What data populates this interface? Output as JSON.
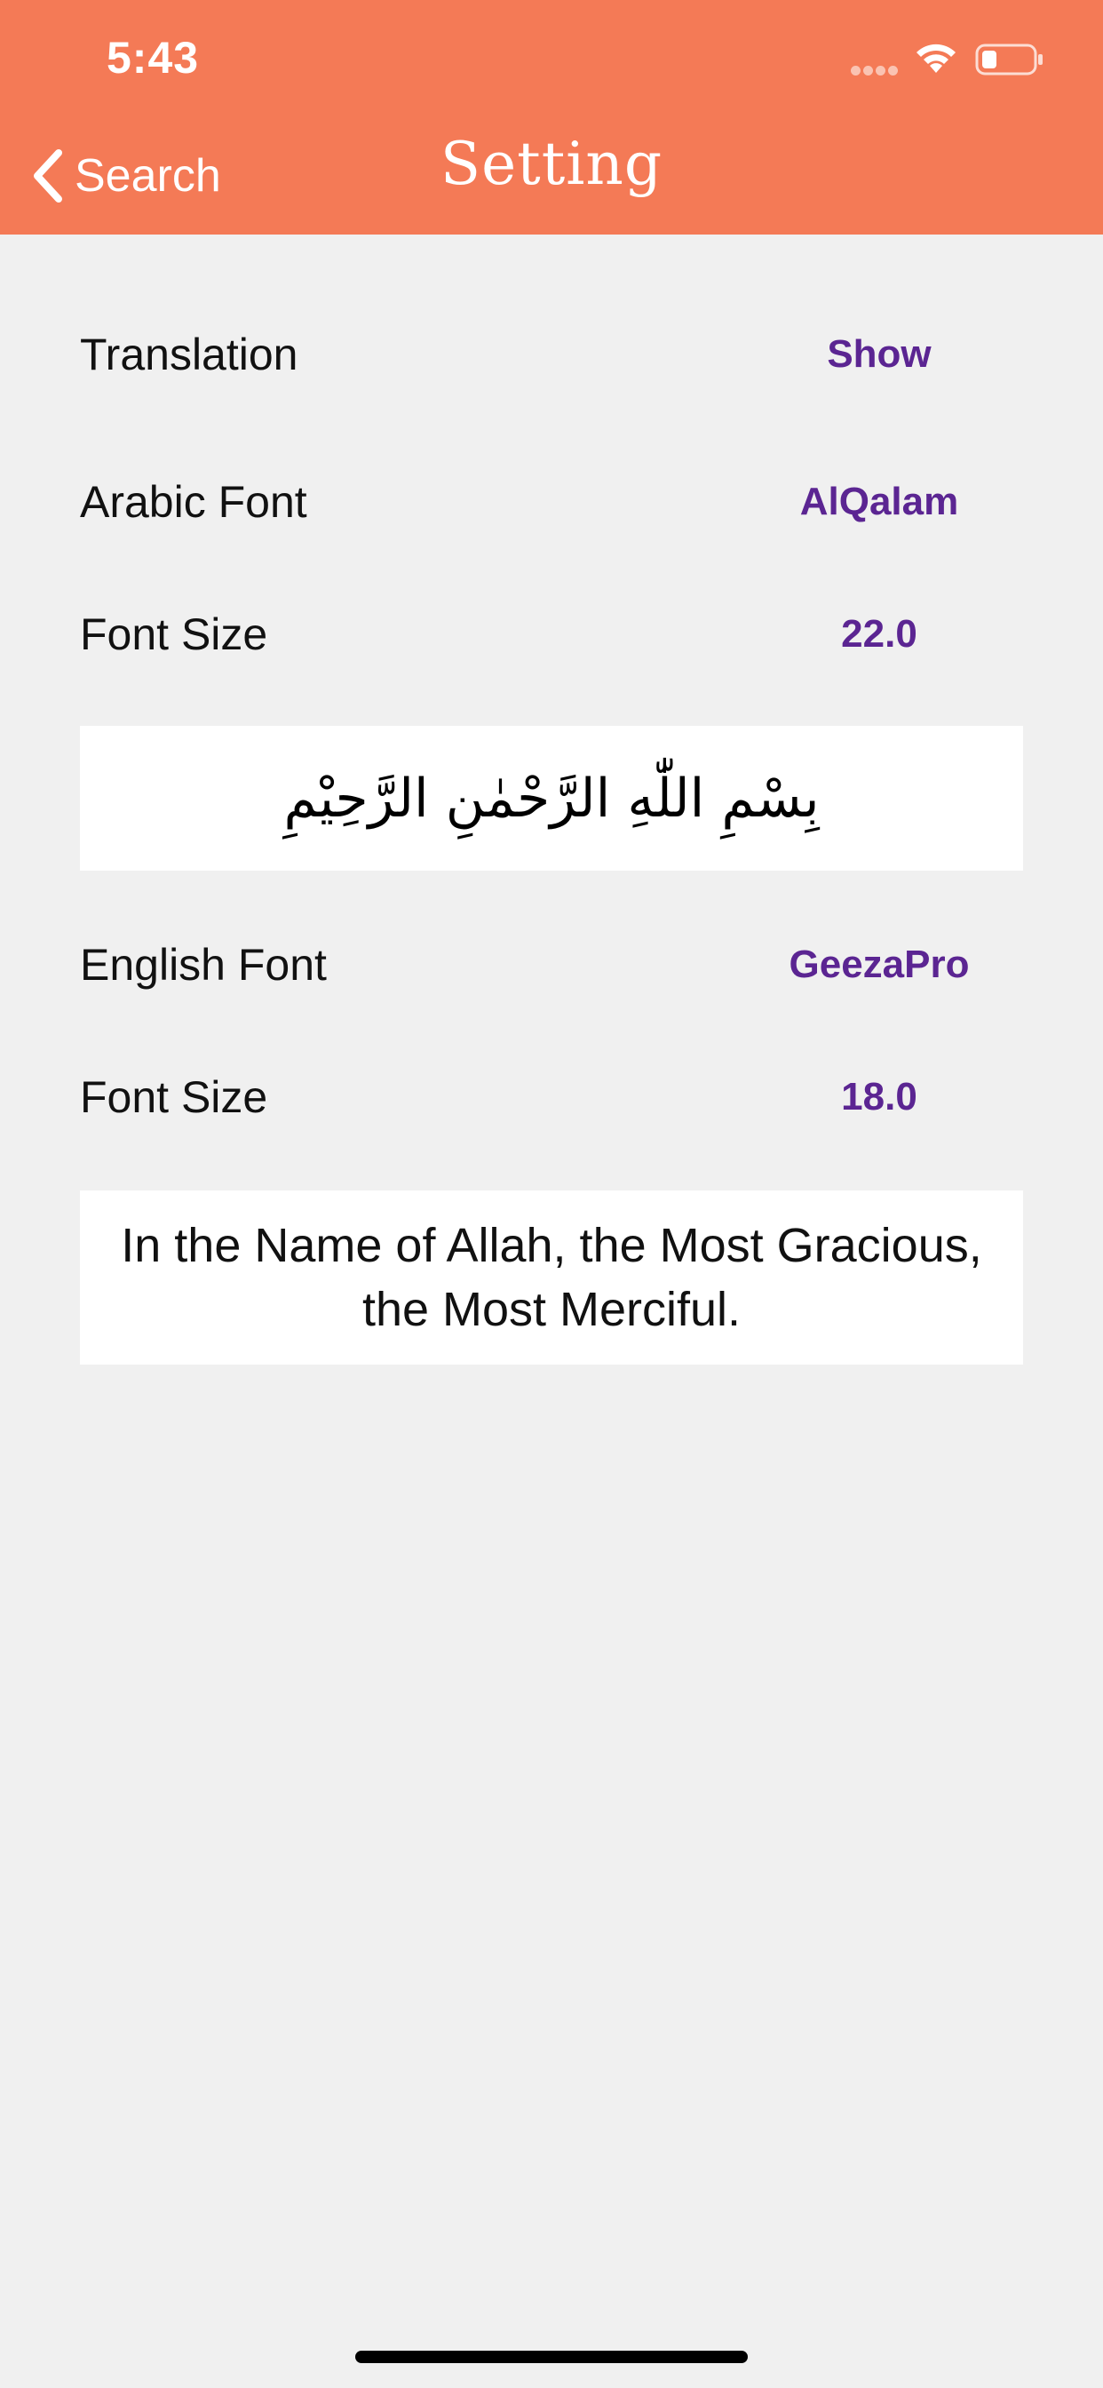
{
  "status_bar": {
    "time": "5:43"
  },
  "nav": {
    "back_label": "Search",
    "title": "Setting"
  },
  "settings": {
    "translation": {
      "label": "Translation",
      "value": "Show"
    },
    "arabic_font": {
      "label": "Arabic Font",
      "value": "AlQalam"
    },
    "arabic_font_size": {
      "label": "Font Size",
      "value": "22.0"
    },
    "arabic_preview": "بِسْمِ اللّٰهِ الرَّحْمٰنِ الرَّحِيْمِ",
    "english_font": {
      "label": "English Font",
      "value": "GeezaPro"
    },
    "english_font_size": {
      "label": "Font Size",
      "value": "18.0"
    },
    "english_preview": "In the Name of Allah, the Most Gracious, the Most Merciful."
  },
  "colors": {
    "nav_bar": "#f47a56",
    "value_accent": "#5b2592",
    "background": "#f0f0f0"
  }
}
